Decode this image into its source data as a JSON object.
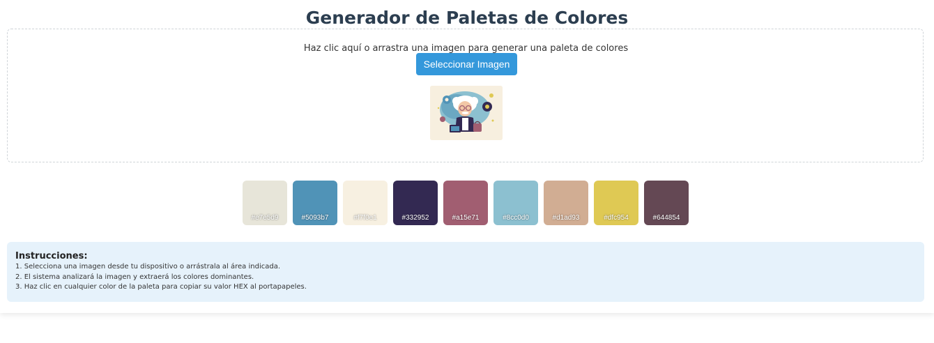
{
  "page": {
    "title": "Generador de Paletas de Colores"
  },
  "dropzone": {
    "text": "Haz clic aquí o arrastra una imagen para generar una paleta de colores",
    "button_label": "Seleccionar Imagen"
  },
  "palette": [
    {
      "hex": "#e7e5d9",
      "label": "#e7e5d9"
    },
    {
      "hex": "#5093b7",
      "label": "#5093b7"
    },
    {
      "hex": "#f7f0e1",
      "label": "#f7f0e1"
    },
    {
      "hex": "#332952",
      "label": "#332952"
    },
    {
      "hex": "#a15e71",
      "label": "#a15e71"
    },
    {
      "hex": "#8cc0d0",
      "label": "#8cc0d0"
    },
    {
      "hex": "#d1ad93",
      "label": "#d1ad93"
    },
    {
      "hex": "#dfc954",
      "label": "#dfc954"
    },
    {
      "hex": "#644854",
      "label": "#644854"
    }
  ],
  "instructions": {
    "title": "Instrucciones:",
    "items": [
      "1. Selecciona una imagen desde tu dispositivo o arrástrala al área indicada.",
      "2. El sistema analizará la imagen y extraerá los colores dominantes.",
      "3. Haz clic en cualquier color de la paleta para copiar su valor HEX al portapapeles."
    ]
  },
  "colors": {
    "accent": "#3498db",
    "title": "#2c3e50",
    "instructions_bg": "#e6f2fb"
  }
}
